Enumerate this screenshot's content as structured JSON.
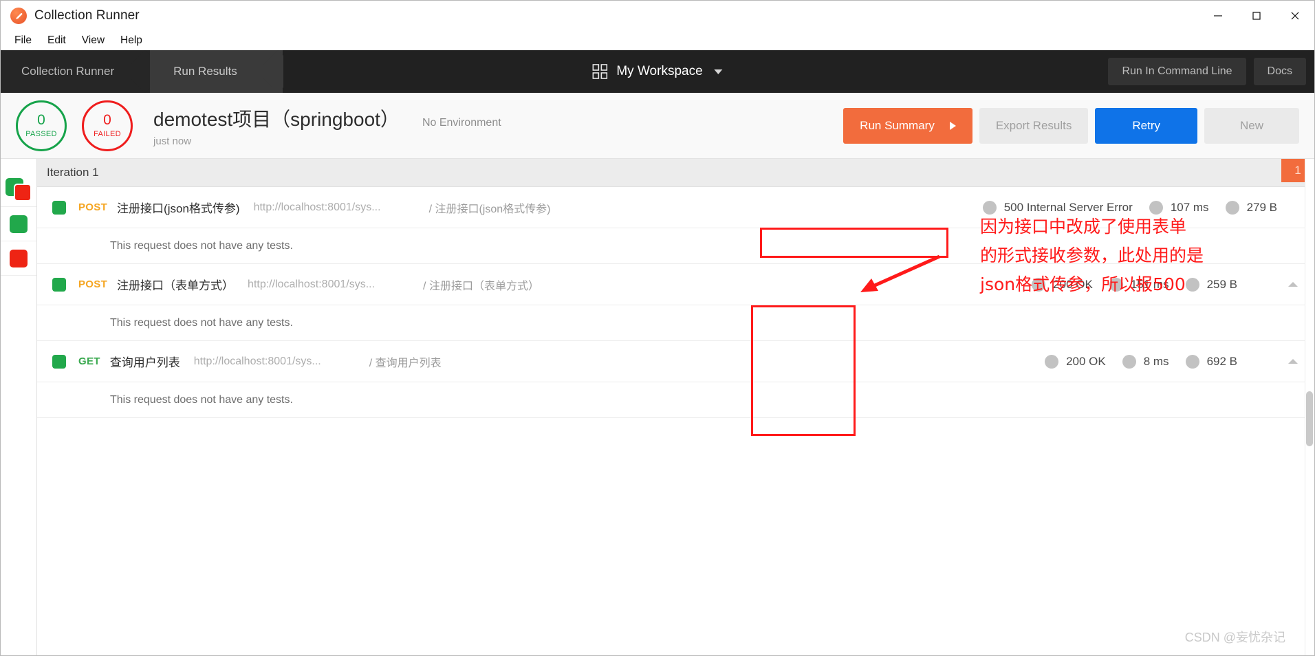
{
  "window": {
    "title": "Collection Runner",
    "logo_icon": "postman-logo-icon",
    "minimize_icon": "minimize-icon",
    "maximize_icon": "maximize-icon",
    "close_icon": "close-icon"
  },
  "menubar": {
    "items": [
      {
        "label": "File"
      },
      {
        "label": "Edit"
      },
      {
        "label": "View"
      },
      {
        "label": "Help"
      }
    ]
  },
  "navbar": {
    "breadcrumbs": [
      {
        "label": "Collection Runner"
      },
      {
        "label": "Run Results"
      }
    ],
    "workspace": {
      "grid_icon": "grid-icon",
      "label": "My Workspace",
      "chevron_icon": "chevron-down-icon"
    },
    "buttons": [
      {
        "label": "Run In Command Line"
      },
      {
        "label": "Docs"
      }
    ]
  },
  "summary": {
    "passed": {
      "count": "0",
      "label": "PASSED",
      "color": "#16a34a"
    },
    "failed": {
      "count": "0",
      "label": "FAILED",
      "color": "#ef1d1d"
    },
    "run_title": "demotest项目（springboot）",
    "environment": "No Environment",
    "timestamp": "just now",
    "actions": {
      "run_summary": "Run Summary",
      "export_results": "Export Results",
      "retry": "Retry",
      "new": "New"
    },
    "colors": {
      "run_summary_bg": "#f26c3d",
      "retry_bg": "#0f73e8",
      "ghost_bg": "#eaeaea"
    }
  },
  "results": {
    "iteration_label": "Iteration 1",
    "iteration_badge": "1",
    "no_tests_message": "This request does not have any tests.",
    "rows": [
      {
        "method": "POST",
        "method_kind": "post",
        "name": "注册接口(json格式传参)",
        "url": "http://localhost:8001/sys...",
        "path": "/ 注册接口(json格式传参)",
        "status": "500 Internal Server Error",
        "time": "107 ms",
        "size": "279 B",
        "has_caret": false
      },
      {
        "method": "POST",
        "method_kind": "post",
        "name": "注册接口（表单方式）",
        "url": "http://localhost:8001/sys...",
        "path": "/ 注册接口（表单方式）",
        "status": "200 OK",
        "time": "151 ms",
        "size": "259 B",
        "has_caret": true
      },
      {
        "method": "GET",
        "method_kind": "get",
        "name": "查询用户列表",
        "url": "http://localhost:8001/sys...",
        "path": "/ 查询用户列表",
        "status": "200 OK",
        "time": "8 ms",
        "size": "692 B",
        "has_caret": true
      }
    ]
  },
  "annotation": {
    "color": "#ff1a1a",
    "line1": "因为接口中改成了使用表单",
    "line2": "的形式接收参数，此处用的是",
    "line3": "json格式传参，所以报500"
  },
  "watermark": "CSDN @妄忧杂记"
}
